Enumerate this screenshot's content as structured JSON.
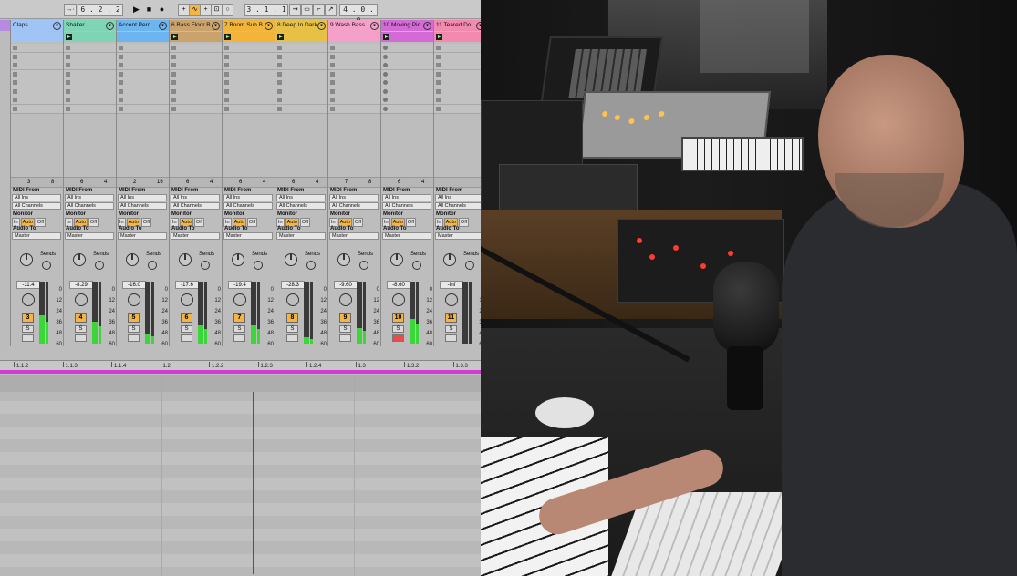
{
  "transport": {
    "left_box": "6 . 2 . 2",
    "position": "3 . 1 . 1",
    "length": "4 . 0 . 0"
  },
  "tracks": [
    {
      "name": "Claps",
      "color": "#9fc4f5",
      "in_num": "3",
      "in_val": "8",
      "vol": "-11.4",
      "num": "3",
      "meter": 0.45
    },
    {
      "name": "Shaker",
      "color": "#7fd4b5",
      "in_num": "6",
      "in_val": "4",
      "vol": "-8.29",
      "num": "4",
      "meter": 0.35
    },
    {
      "name": "Accent Perc",
      "color": "#6cb5f0",
      "in_num": "2",
      "in_val": "16",
      "vol": "-16.0",
      "num": "5",
      "meter": 0.15
    },
    {
      "name": "6 Bass Floor B",
      "color": "#c9a36b",
      "in_num": "6",
      "in_val": "4",
      "vol": "-17.6",
      "num": "6",
      "meter": 0.3
    },
    {
      "name": "7 Boom Sub B",
      "color": "#f2b53a",
      "in_num": "6",
      "in_val": "4",
      "vol": "-19.4",
      "num": "7",
      "meter": 0.3
    },
    {
      "name": "8 Deep In Dark",
      "color": "#e7c145",
      "in_num": "6",
      "in_val": "4",
      "vol": "-28.3",
      "num": "8",
      "meter": 0.1
    },
    {
      "name": "9 Wash Bass",
      "color": "#f4a0c8",
      "in_num": "7",
      "in_val": "8",
      "vol": "-9.60",
      "num": "9",
      "meter": 0.25
    },
    {
      "name": "10 Moving Pic",
      "color": "#d46ad6",
      "in_num": "6",
      "in_val": "4",
      "vol": "-8.60",
      "num": "10",
      "meter": 0.4
    },
    {
      "name": "11 Teared Do",
      "color": "#f28ab0",
      "in_num": "",
      "in_val": "",
      "vol": "-Inf",
      "num": "11",
      "meter": 0.0
    }
  ],
  "io": {
    "midi_from": "MIDI From",
    "all_ins": "All Ins",
    "all_channels": "All Channels",
    "monitor": "Monitor",
    "in": "In",
    "auto": "Auto",
    "off": "Off",
    "audio_to": "Audio To",
    "master": "Master",
    "sends": "Sends",
    "solo": "S"
  },
  "scale": [
    "0",
    "12",
    "24",
    "36",
    "48",
    "60"
  ],
  "ruler": [
    "1.1.2",
    "1.1.3",
    "1.1.4",
    "1.2",
    "1.2.2",
    "1.2.3",
    "1.2.4",
    "1.3",
    "1.3.2",
    "1.3.3"
  ],
  "colors": {
    "accent_orange": "#f5b542",
    "loop_magenta": "#d63ad6",
    "meter_green": "#3ad63a",
    "arm_red": "#e84c4c"
  }
}
